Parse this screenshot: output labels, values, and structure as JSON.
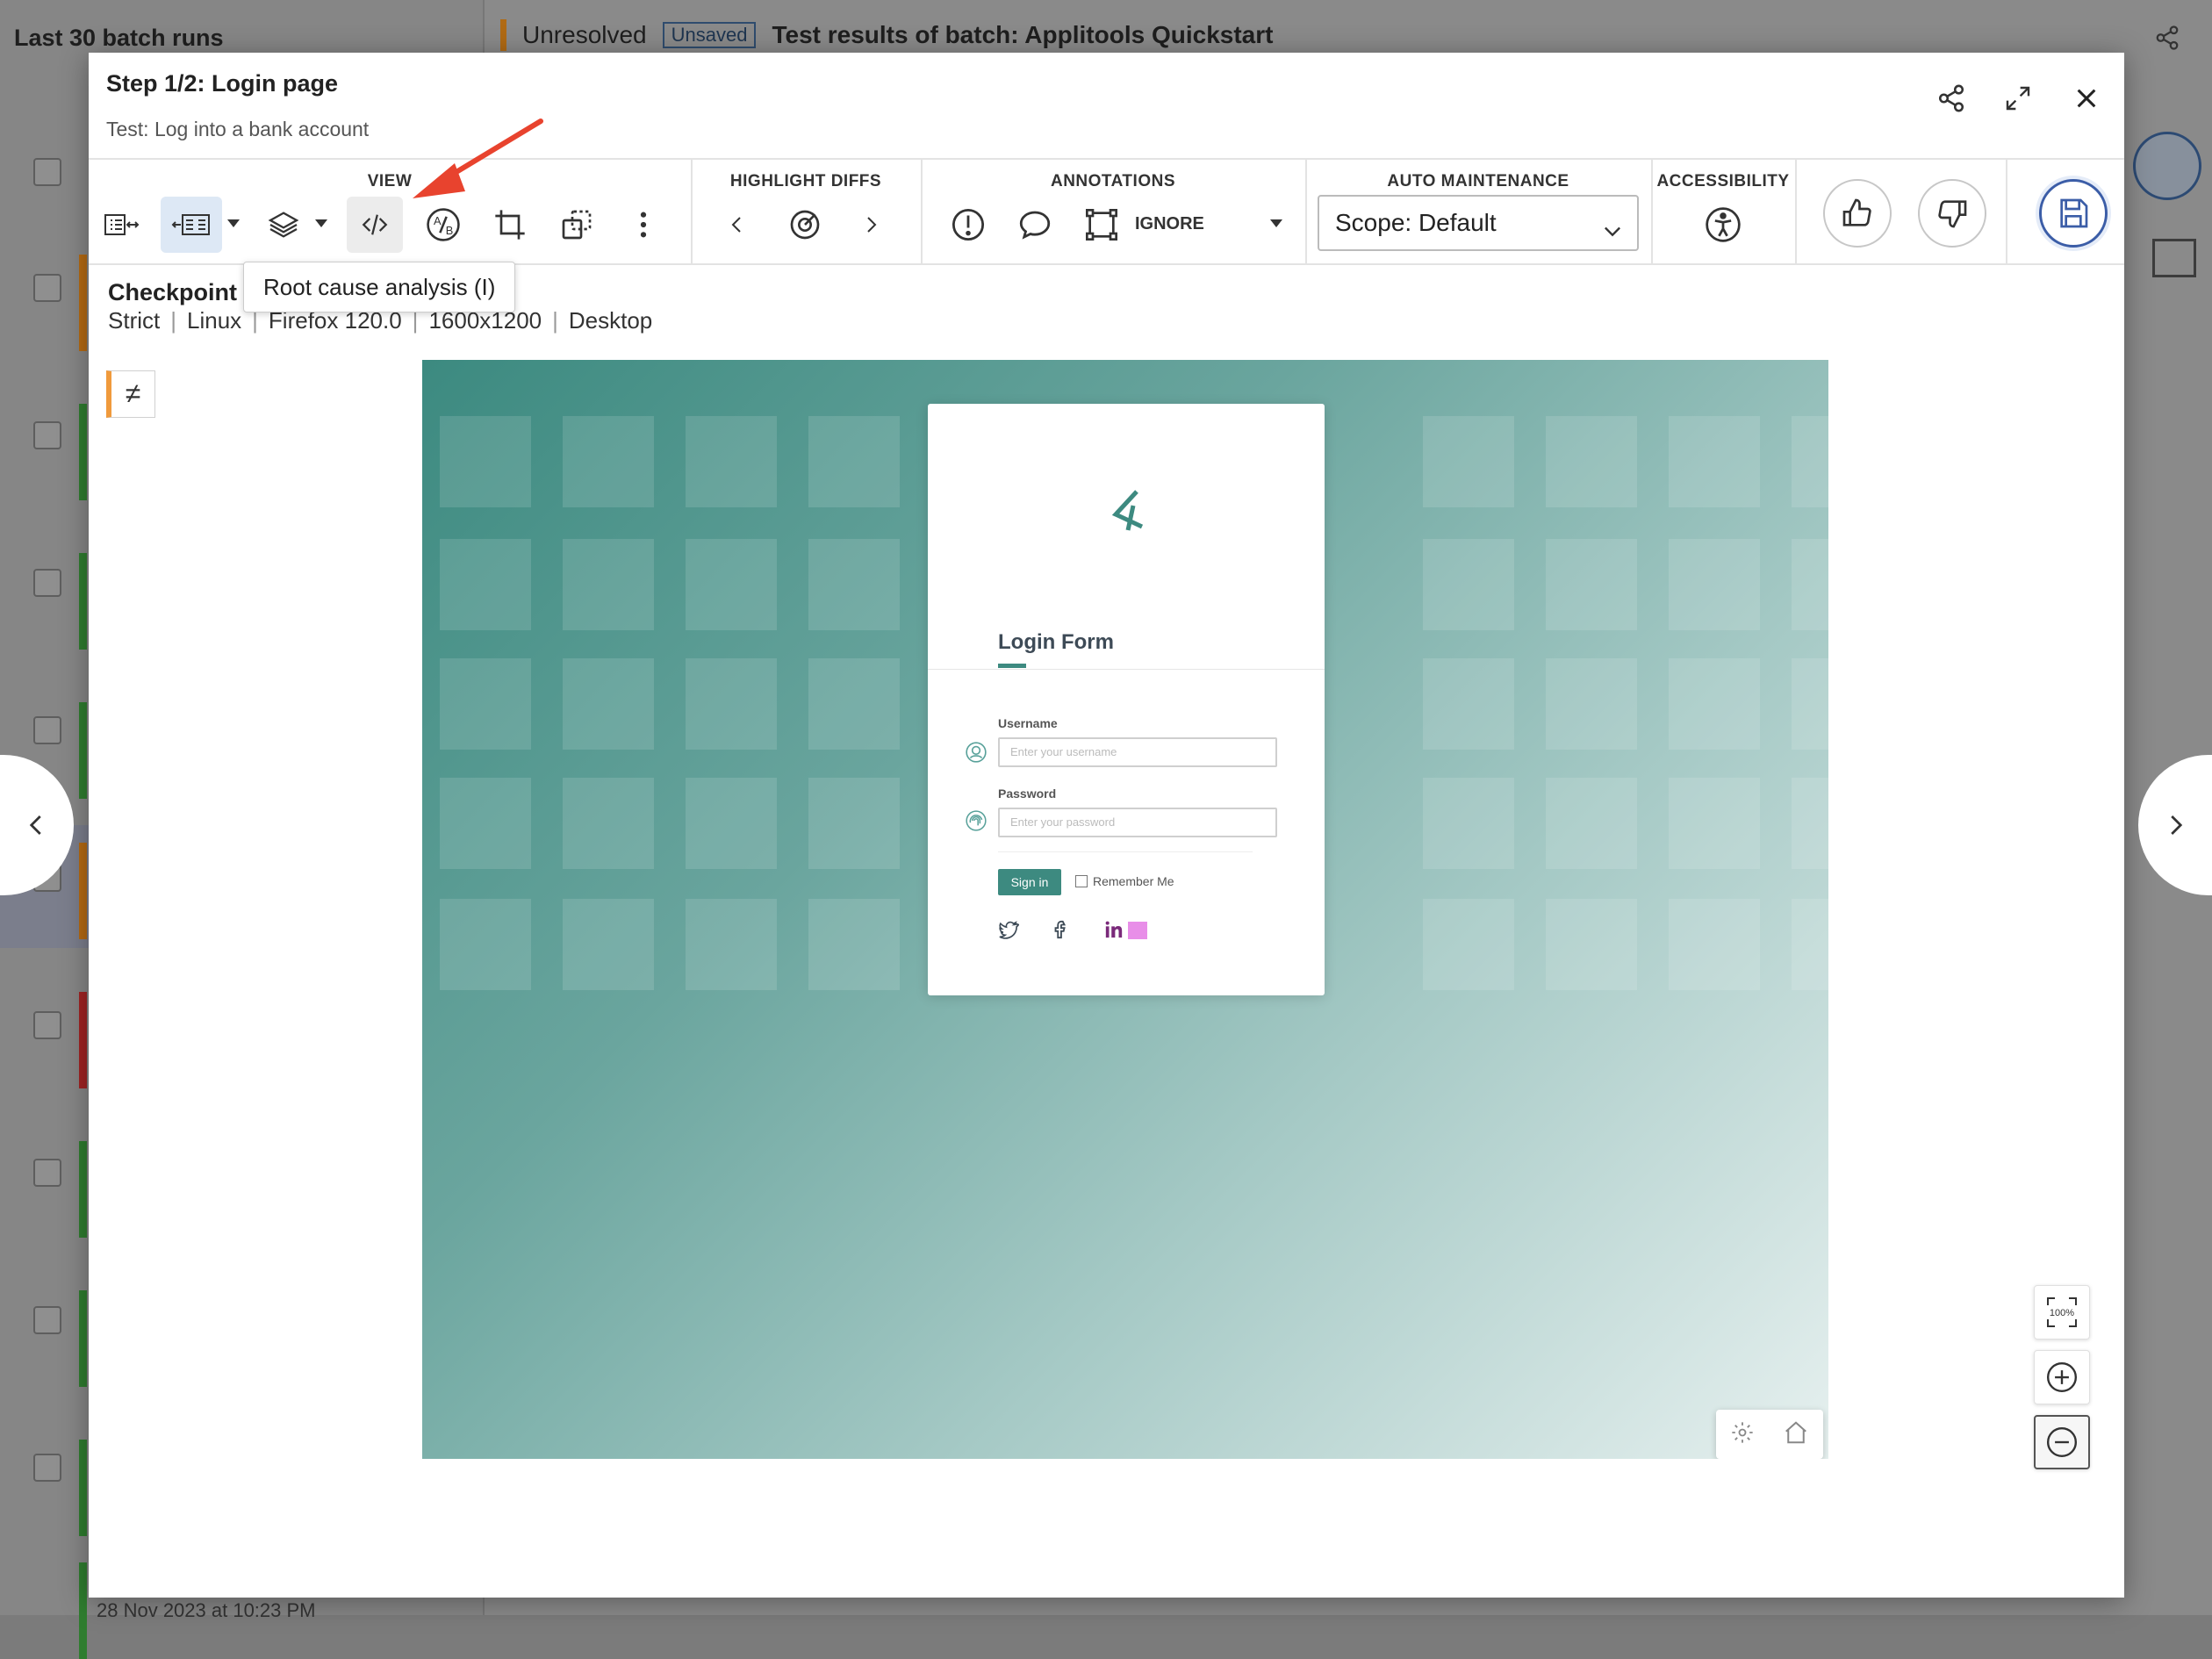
{
  "background": {
    "left_title": "Last 30 batch runs",
    "status": "Unresolved",
    "unsaved_tag": "Unsaved",
    "test_results_title": "Test results of batch:  Applitools Quickstart",
    "row_date": "28 Nov 2023 at 10:23 PM",
    "row_bar_colors": [
      "#b56a12",
      "#2f7d2f",
      "#2f7d2f",
      "#2f7d2f",
      "#b56a12",
      "#a02323",
      "#2f7d2f",
      "#2f7d2f",
      "#2f7d2f",
      "#2f7d2f"
    ]
  },
  "modal": {
    "step_title": "Step 1/2:  Login page",
    "test_name": "Test: Log into a bank account",
    "header_icons": [
      "share-icon",
      "expand-icon",
      "close-icon"
    ]
  },
  "toolbar": {
    "view_label": "VIEW",
    "highlight_label": "HIGHLIGHT DIFFS",
    "annotations_label": "ANNOTATIONS",
    "ignore_label": "IGNORE",
    "auto_maintenance_label": "AUTO MAINTENANCE",
    "scope_value": "Scope: Default",
    "accessibility_label": "ACCESSIBILITY"
  },
  "tooltip": "Root cause analysis (I)",
  "checkpoint": {
    "title": "Checkpoint",
    "match_level": "Strict",
    "os": "Linux",
    "browser": "Firefox 120.0",
    "viewport": "1600x1200",
    "device": "Desktop",
    "diff_symbol": "≠"
  },
  "screenshot": {
    "form_title": "Login Form",
    "username_label": "Username",
    "username_placeholder": "Enter your username",
    "password_label": "Password",
    "password_placeholder": "Enter your password",
    "signin_label": "Sign in",
    "remember_label": "Remember Me",
    "accent_color": "#3d8a80"
  },
  "zoom": {
    "reset_label": "100%"
  },
  "colors": {
    "active_blue": "#3b5da7",
    "arrow_red": "#e8432e",
    "diff_orange": "#f09a3c"
  }
}
